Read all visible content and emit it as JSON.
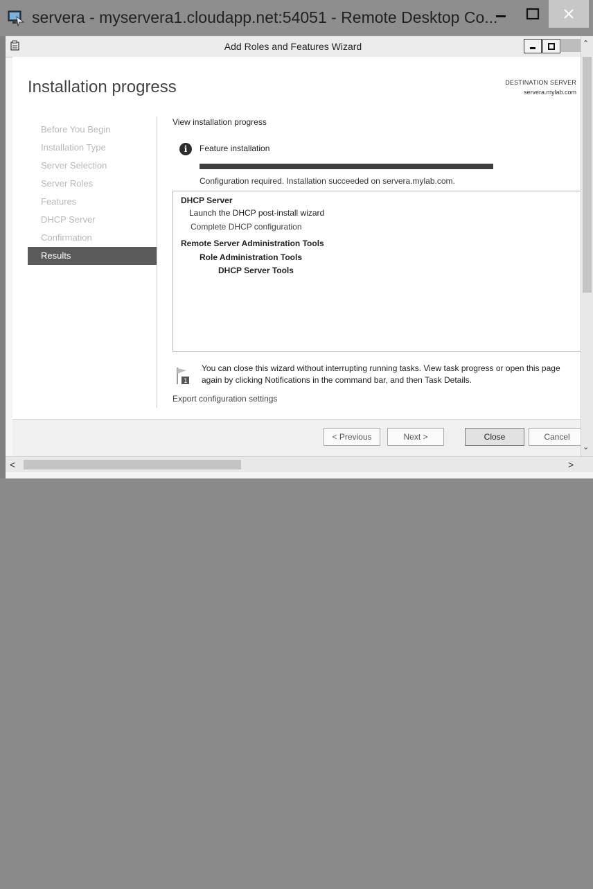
{
  "rdp": {
    "title": "servera - myservera1.cloudapp.net:54051 - Remote Desktop Co...",
    "minimize_icon": "minimize-icon",
    "maximize_icon": "maximize-icon",
    "close_icon": "close-icon"
  },
  "window": {
    "title": "Add Roles and Features Wizard"
  },
  "wizard": {
    "page_title": "Installation progress",
    "destination_label": "DESTINATION SERVER",
    "destination_server": "servera.mylab.com",
    "steps": [
      {
        "label": "Before You Begin",
        "active": false
      },
      {
        "label": "Installation Type",
        "active": false
      },
      {
        "label": "Server Selection",
        "active": false
      },
      {
        "label": "Server Roles",
        "active": false
      },
      {
        "label": "Features",
        "active": false
      },
      {
        "label": "DHCP Server",
        "active": false
      },
      {
        "label": "Confirmation",
        "active": false
      },
      {
        "label": "Results",
        "active": true
      }
    ],
    "main": {
      "heading": "View installation progress",
      "feature_label": "Feature installation",
      "progress_fraction": 1.0,
      "status": "Configuration required. Installation succeeded on servera.mylab.com.",
      "results": [
        {
          "text": "DHCP Server",
          "bold": true
        },
        {
          "text": "Launch the DHCP post-install wizard",
          "bold": false
        },
        {
          "text": "Complete DHCP configuration",
          "bold": false,
          "link": true
        },
        {
          "text": "Remote Server Administration Tools",
          "bold": true
        },
        {
          "text": "Role Administration Tools",
          "bold": true
        },
        {
          "text": "DHCP Server Tools",
          "bold": true
        }
      ],
      "note": "You can close this wizard without interrupting running tasks. View task progress or open this page again by clicking Notifications in the command bar, and then Task Details.",
      "export_link": "Export configuration settings"
    },
    "buttons": {
      "previous": "< Previous",
      "next": "Next >",
      "close": "Close",
      "cancel": "Cancel"
    }
  }
}
